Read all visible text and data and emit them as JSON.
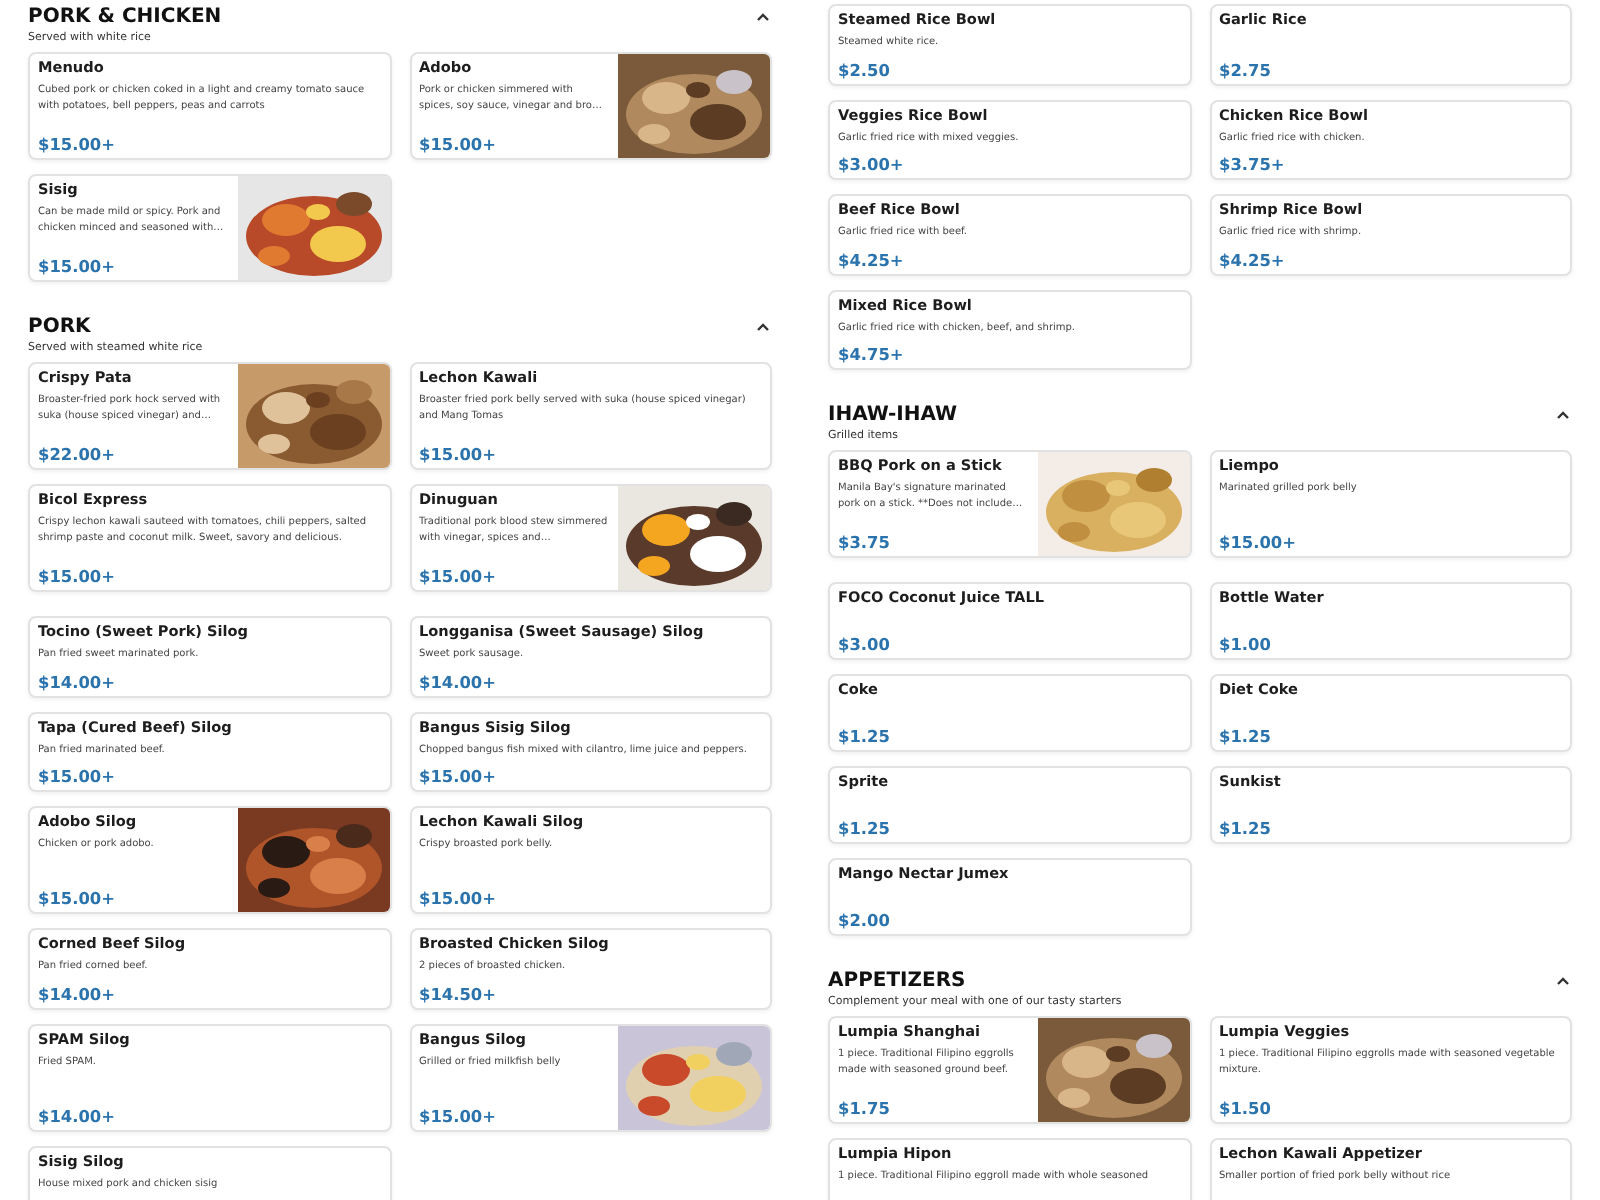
{
  "columns": [
    {
      "sections": [
        {
          "title": "PORK & CHICKEN",
          "subtitle": "Served with white rice",
          "expanded": true,
          "items": [
            {
              "kind": "plain",
              "name": "Menudo",
              "description": "Cubed pork or chicken coked in a light and creamy tomato sauce with potatoes, bell peppers, peas and carrots",
              "price": "$15.00+"
            },
            {
              "name": "Adobo",
              "description": "Pork or chicken simmered with spices, soy sauce, vinegar and bro…",
              "price": "$15.00+"
            },
            {
              "name": "Sisig",
              "description": "Can be made mild or spicy. Pork and chicken minced and seasoned with…",
              "price": "$15.00+"
            }
          ]
        },
        {
          "title": "PORK",
          "subtitle": "Served with steamed white rice",
          "expanded": true,
          "items": [
            {
              "name": "Crispy Pata",
              "description": "Broaster-fried pork hock served with suka (house spiced vinegar) and…",
              "price": "$22.00+"
            },
            {
              "kind": "plain",
              "name": "Lechon Kawali",
              "description": "Broaster fried pork belly served with suka (house spiced vinegar) and Mang Tomas",
              "price": "$15.00+"
            },
            {
              "kind": "plain",
              "name": "Bicol Express",
              "description": "Crispy lechon kawali sauteed with tomatoes, chili peppers, salted shrimp paste and coconut milk. Sweet, savory and delicious.",
              "price": "$15.00+"
            },
            {
              "name": "Dinuguan",
              "description": "Traditional pork blood stew simmered with vinegar, spices and…",
              "price": "$15.00+"
            }
          ]
        },
        {
          "items": [
            {
              "kind": "plain",
              "name": "Tocino (Sweet Pork) Silog",
              "description": "Pan fried sweet marinated pork.",
              "price": "$14.00+"
            },
            {
              "kind": "plain",
              "name": "Longganisa (Sweet Sausage) Silog",
              "description": "Sweet pork sausage.",
              "price": "$14.00+"
            },
            {
              "kind": "plain",
              "name": "Tapa (Cured Beef) Silog",
              "description": "Pan fried marinated beef.",
              "price": "$15.00+"
            },
            {
              "kind": "plain",
              "name": "Bangus Sisig Silog",
              "description": "Chopped bangus fish mixed with cilantro, lime juice and peppers.",
              "price": "$15.00+"
            },
            {
              "name": "Adobo Silog",
              "description": "Chicken or pork adobo.",
              "price": "$15.00+"
            },
            {
              "kind": "plain",
              "name": "Lechon Kawali Silog",
              "description": "Crispy broasted pork belly.",
              "price": "$15.00+"
            },
            {
              "kind": "plain",
              "name": "Corned Beef Silog",
              "description": "Pan fried corned beef.",
              "price": "$14.00+"
            },
            {
              "kind": "plain",
              "name": "Broasted Chicken Silog",
              "description": "2 pieces of broasted chicken.",
              "price": "$14.50+"
            },
            {
              "kind": "plain",
              "name": "SPAM Silog",
              "description": "Fried SPAM.",
              "price": "$14.00+"
            },
            {
              "name": "Bangus Silog",
              "description": "Grilled or fried milkfish belly",
              "price": "$15.00+"
            },
            {
              "kind": "plain",
              "name": "Sisig Silog",
              "description": "House mixed pork and chicken sisig"
            }
          ]
        }
      ]
    },
    {
      "sections": [
        {
          "items": [
            {
              "kind": "plain",
              "name": "Steamed Rice Bowl",
              "description": "Steamed white rice.",
              "price": "$2.50"
            },
            {
              "kind": "plain",
              "name": "Garlic Rice",
              "price": "$2.75"
            },
            {
              "kind": "plain",
              "name": "Veggies Rice Bowl",
              "description": "Garlic fried rice with mixed veggies.",
              "price": "$3.00+"
            },
            {
              "kind": "plain",
              "name": "Chicken Rice Bowl",
              "description": "Garlic fried rice with chicken.",
              "price": "$3.75+"
            },
            {
              "kind": "plain",
              "name": "Beef Rice Bowl",
              "description": "Garlic fried rice with beef.",
              "price": "$4.25+"
            },
            {
              "kind": "plain",
              "name": "Shrimp Rice Bowl",
              "description": "Garlic fried rice with shrimp.",
              "price": "$4.25+"
            },
            {
              "kind": "plain",
              "name": "Mixed Rice Bowl",
              "description": "Garlic fried rice with chicken, beef, and shrimp.",
              "price": "$4.75+"
            }
          ]
        },
        {
          "title": "IHAW-IHAW",
          "subtitle": "Grilled items",
          "expanded": true,
          "items": [
            {
              "name": "BBQ Pork on a Stick",
              "description": "Manila Bay's signature marinated pork on a stick. **Does not include…",
              "price": "$3.75"
            },
            {
              "kind": "plain",
              "name": "Liempo",
              "description": "Marinated grilled pork belly",
              "price": "$15.00+"
            }
          ]
        },
        {
          "items": [
            {
              "kind": "plain",
              "name": "FOCO Coconut Juice TALL",
              "price": "$3.00"
            },
            {
              "kind": "plain",
              "name": "Bottle Water",
              "price": "$1.00"
            },
            {
              "kind": "plain",
              "name": "Coke",
              "price": "$1.25"
            },
            {
              "kind": "plain",
              "name": "Diet Coke",
              "price": "$1.25"
            },
            {
              "kind": "plain",
              "name": "Sprite",
              "price": "$1.25"
            },
            {
              "kind": "plain",
              "name": "Sunkist",
              "price": "$1.25"
            },
            {
              "kind": "plain",
              "name": "Mango Nectar Jumex",
              "price": "$2.00"
            }
          ]
        },
        {
          "title": "APPETIZERS",
          "subtitle": "Complement your meal with one of our tasty starters",
          "expanded": true,
          "items": [
            {
              "name": "Lumpia Shanghai",
              "description": "1 piece. Traditional Filipino eggrolls made with seasoned ground beef.",
              "price": "$1.75"
            },
            {
              "kind": "plain",
              "name": "Lumpia Veggies",
              "description": "1 piece. Traditional Filipino eggrolls made with seasoned vegetable mixture.",
              "price": "$1.50"
            },
            {
              "kind": "plain",
              "name": "Lumpia Hipon",
              "description": "1 piece. Traditional Filipino eggroll made with whole seasoned"
            },
            {
              "kind": "plain",
              "name": "Lechon Kawali Appetizer",
              "description": "Smaller portion of fried pork belly without rice"
            }
          ]
        }
      ]
    }
  ]
}
